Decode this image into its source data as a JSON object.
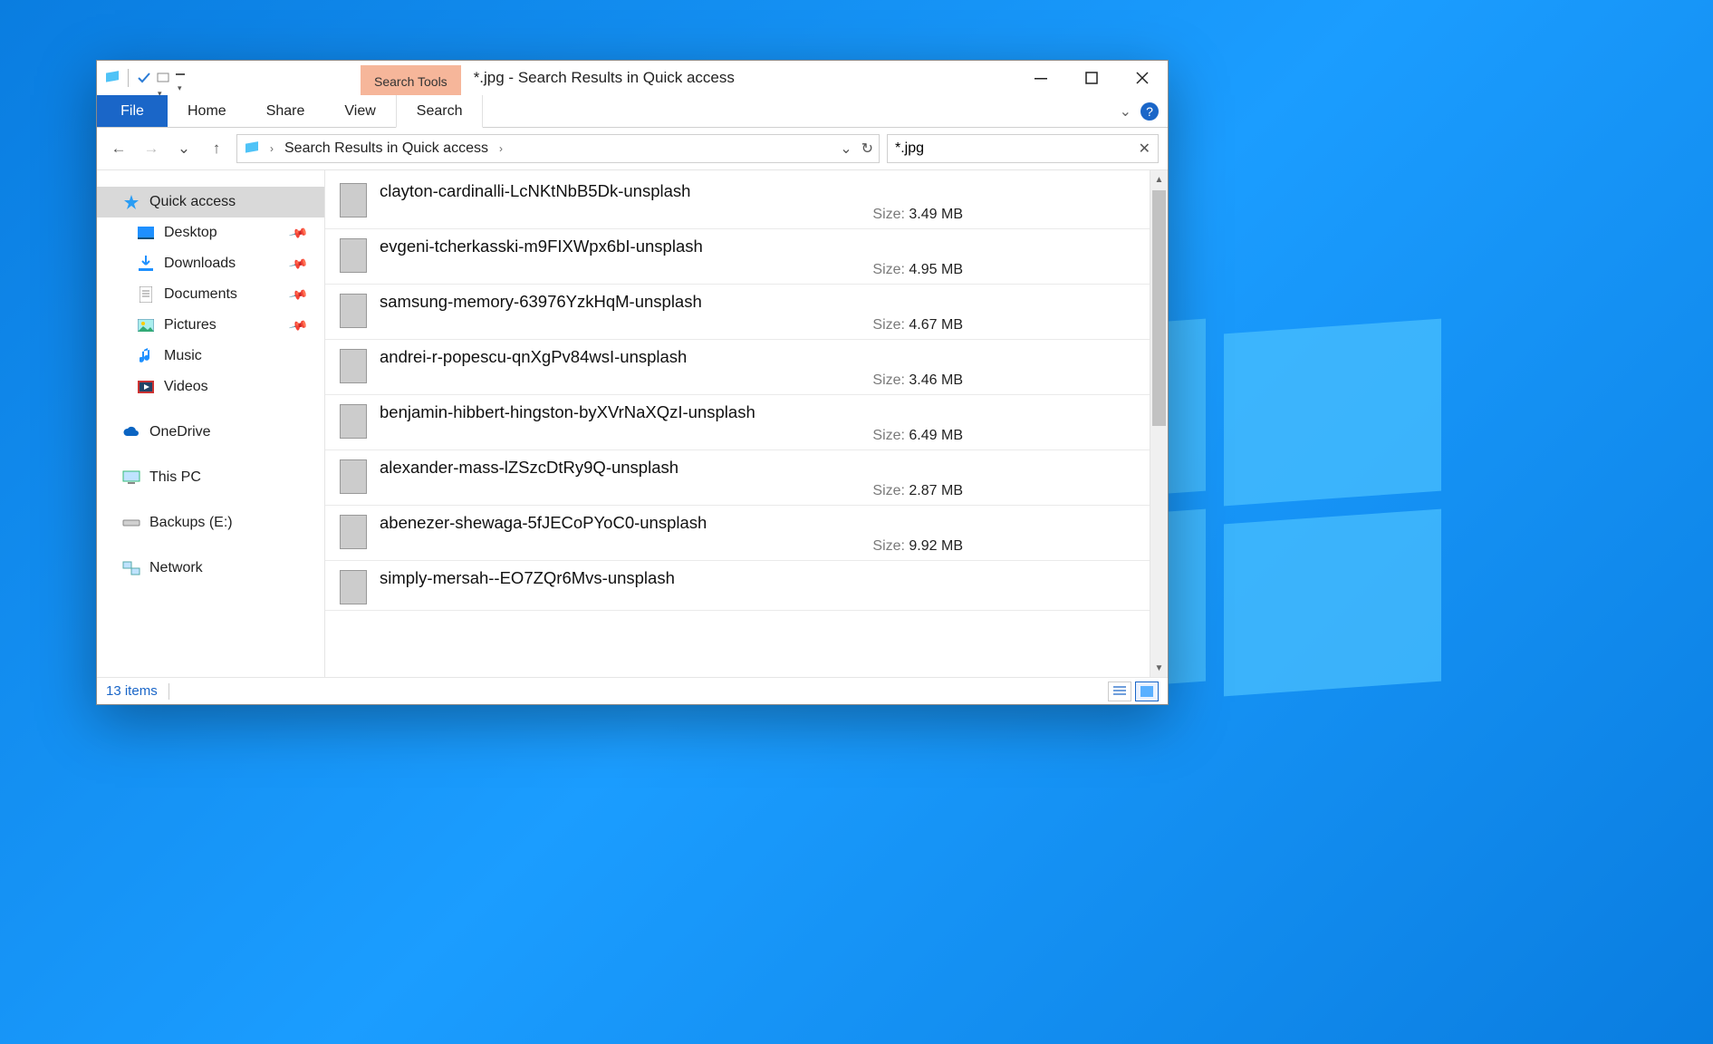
{
  "title": "*.jpg - Search Results in Quick access",
  "search_tools_label": "Search Tools",
  "ribbon": {
    "file": "File",
    "tabs": [
      "Home",
      "Share",
      "View",
      "Search"
    ]
  },
  "address": {
    "location": "Search Results in Quick access"
  },
  "search": {
    "value": "*.jpg"
  },
  "nav": {
    "quick_access": "Quick access",
    "items": [
      {
        "label": "Desktop",
        "icon": "desktop",
        "pinned": true
      },
      {
        "label": "Downloads",
        "icon": "downloads",
        "pinned": true
      },
      {
        "label": "Documents",
        "icon": "documents",
        "pinned": true
      },
      {
        "label": "Pictures",
        "icon": "pictures",
        "pinned": true
      },
      {
        "label": "Music",
        "icon": "music",
        "pinned": false
      },
      {
        "label": "Videos",
        "icon": "videos",
        "pinned": false
      }
    ],
    "onedrive": "OneDrive",
    "thispc": "This PC",
    "backups": "Backups (E:)",
    "network": "Network"
  },
  "size_label": "Size:",
  "results": [
    {
      "name": "clayton-cardinalli-LcNKtNbB5Dk-unsplash",
      "size": "3.49 MB"
    },
    {
      "name": "evgeni-tcherkasski-m9FIXWpx6bI-unsplash",
      "size": "4.95 MB"
    },
    {
      "name": "samsung-memory-63976YzkHqM-unsplash",
      "size": "4.67 MB"
    },
    {
      "name": "andrei-r-popescu-qnXgPv84wsI-unsplash",
      "size": "3.46 MB"
    },
    {
      "name": "benjamin-hibbert-hingston-byXVrNaXQzI-unsplash",
      "size": "6.49 MB"
    },
    {
      "name": "alexander-mass-lZSzcDtRy9Q-unsplash",
      "size": "2.87 MB"
    },
    {
      "name": "abenezer-shewaga-5fJECoPYoC0-unsplash",
      "size": "9.92 MB"
    },
    {
      "name": "simply-mersah--EO7ZQr6Mvs-unsplash",
      "size": ""
    }
  ],
  "status": {
    "item_count": "13 items"
  }
}
